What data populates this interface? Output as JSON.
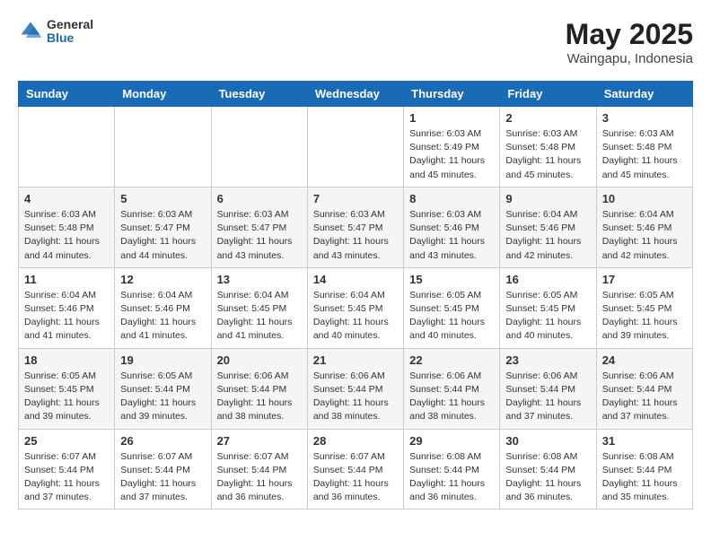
{
  "header": {
    "logo_general": "General",
    "logo_blue": "Blue",
    "title": "May 2025",
    "subtitle": "Waingapu, Indonesia"
  },
  "columns": [
    "Sunday",
    "Monday",
    "Tuesday",
    "Wednesday",
    "Thursday",
    "Friday",
    "Saturday"
  ],
  "weeks": [
    [
      {
        "day": "",
        "info": ""
      },
      {
        "day": "",
        "info": ""
      },
      {
        "day": "",
        "info": ""
      },
      {
        "day": "",
        "info": ""
      },
      {
        "day": "1",
        "info": "Sunrise: 6:03 AM\nSunset: 5:49 PM\nDaylight: 11 hours and 45 minutes."
      },
      {
        "day": "2",
        "info": "Sunrise: 6:03 AM\nSunset: 5:48 PM\nDaylight: 11 hours and 45 minutes."
      },
      {
        "day": "3",
        "info": "Sunrise: 6:03 AM\nSunset: 5:48 PM\nDaylight: 11 hours and 45 minutes."
      }
    ],
    [
      {
        "day": "4",
        "info": "Sunrise: 6:03 AM\nSunset: 5:48 PM\nDaylight: 11 hours and 44 minutes."
      },
      {
        "day": "5",
        "info": "Sunrise: 6:03 AM\nSunset: 5:47 PM\nDaylight: 11 hours and 44 minutes."
      },
      {
        "day": "6",
        "info": "Sunrise: 6:03 AM\nSunset: 5:47 PM\nDaylight: 11 hours and 43 minutes."
      },
      {
        "day": "7",
        "info": "Sunrise: 6:03 AM\nSunset: 5:47 PM\nDaylight: 11 hours and 43 minutes."
      },
      {
        "day": "8",
        "info": "Sunrise: 6:03 AM\nSunset: 5:46 PM\nDaylight: 11 hours and 43 minutes."
      },
      {
        "day": "9",
        "info": "Sunrise: 6:04 AM\nSunset: 5:46 PM\nDaylight: 11 hours and 42 minutes."
      },
      {
        "day": "10",
        "info": "Sunrise: 6:04 AM\nSunset: 5:46 PM\nDaylight: 11 hours and 42 minutes."
      }
    ],
    [
      {
        "day": "11",
        "info": "Sunrise: 6:04 AM\nSunset: 5:46 PM\nDaylight: 11 hours and 41 minutes."
      },
      {
        "day": "12",
        "info": "Sunrise: 6:04 AM\nSunset: 5:46 PM\nDaylight: 11 hours and 41 minutes."
      },
      {
        "day": "13",
        "info": "Sunrise: 6:04 AM\nSunset: 5:45 PM\nDaylight: 11 hours and 41 minutes."
      },
      {
        "day": "14",
        "info": "Sunrise: 6:04 AM\nSunset: 5:45 PM\nDaylight: 11 hours and 40 minutes."
      },
      {
        "day": "15",
        "info": "Sunrise: 6:05 AM\nSunset: 5:45 PM\nDaylight: 11 hours and 40 minutes."
      },
      {
        "day": "16",
        "info": "Sunrise: 6:05 AM\nSunset: 5:45 PM\nDaylight: 11 hours and 40 minutes."
      },
      {
        "day": "17",
        "info": "Sunrise: 6:05 AM\nSunset: 5:45 PM\nDaylight: 11 hours and 39 minutes."
      }
    ],
    [
      {
        "day": "18",
        "info": "Sunrise: 6:05 AM\nSunset: 5:45 PM\nDaylight: 11 hours and 39 minutes."
      },
      {
        "day": "19",
        "info": "Sunrise: 6:05 AM\nSunset: 5:44 PM\nDaylight: 11 hours and 39 minutes."
      },
      {
        "day": "20",
        "info": "Sunrise: 6:06 AM\nSunset: 5:44 PM\nDaylight: 11 hours and 38 minutes."
      },
      {
        "day": "21",
        "info": "Sunrise: 6:06 AM\nSunset: 5:44 PM\nDaylight: 11 hours and 38 minutes."
      },
      {
        "day": "22",
        "info": "Sunrise: 6:06 AM\nSunset: 5:44 PM\nDaylight: 11 hours and 38 minutes."
      },
      {
        "day": "23",
        "info": "Sunrise: 6:06 AM\nSunset: 5:44 PM\nDaylight: 11 hours and 37 minutes."
      },
      {
        "day": "24",
        "info": "Sunrise: 6:06 AM\nSunset: 5:44 PM\nDaylight: 11 hours and 37 minutes."
      }
    ],
    [
      {
        "day": "25",
        "info": "Sunrise: 6:07 AM\nSunset: 5:44 PM\nDaylight: 11 hours and 37 minutes."
      },
      {
        "day": "26",
        "info": "Sunrise: 6:07 AM\nSunset: 5:44 PM\nDaylight: 11 hours and 37 minutes."
      },
      {
        "day": "27",
        "info": "Sunrise: 6:07 AM\nSunset: 5:44 PM\nDaylight: 11 hours and 36 minutes."
      },
      {
        "day": "28",
        "info": "Sunrise: 6:07 AM\nSunset: 5:44 PM\nDaylight: 11 hours and 36 minutes."
      },
      {
        "day": "29",
        "info": "Sunrise: 6:08 AM\nSunset: 5:44 PM\nDaylight: 11 hours and 36 minutes."
      },
      {
        "day": "30",
        "info": "Sunrise: 6:08 AM\nSunset: 5:44 PM\nDaylight: 11 hours and 36 minutes."
      },
      {
        "day": "31",
        "info": "Sunrise: 6:08 AM\nSunset: 5:44 PM\nDaylight: 11 hours and 35 minutes."
      }
    ]
  ]
}
